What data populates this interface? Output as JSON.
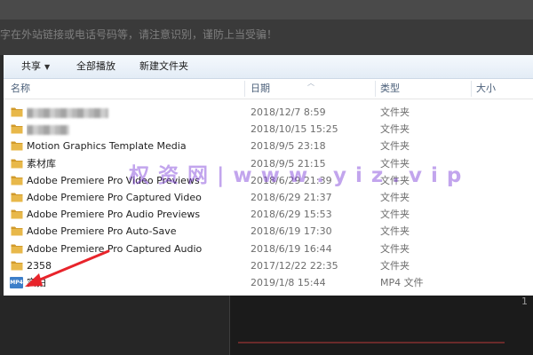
{
  "background": {
    "top_text": "字在外站链接或电话号码等，请注意识别，谨防上当受骗！",
    "bottom_number": "1"
  },
  "toolbar": {
    "share_label": "共享",
    "play_all_label": "全部播放",
    "new_folder_label": "新建文件夹"
  },
  "columns": {
    "name": "名称",
    "date": "日期",
    "type": "类型",
    "size": "大小"
  },
  "files": [
    {
      "name": "",
      "date": "2018/12/7 8:59",
      "type": "文件夹",
      "icon": "folder-icon",
      "blurred": true
    },
    {
      "name": "",
      "date": "2018/10/15 15:25",
      "type": "文件夹",
      "icon": "folder-icon",
      "blurred": true
    },
    {
      "name": "Motion Graphics Template Media",
      "date": "2018/9/5 23:18",
      "type": "文件夹",
      "icon": "folder-icon"
    },
    {
      "name": "素材库",
      "date": "2018/9/5 21:15",
      "type": "文件夹",
      "icon": "folder-icon"
    },
    {
      "name": "Adobe Premiere Pro Video Previews",
      "date": "2018/6/29 21:39",
      "type": "文件夹",
      "icon": "folder-icon"
    },
    {
      "name": "Adobe Premiere Pro Captured Video",
      "date": "2018/6/29 21:37",
      "type": "文件夹",
      "icon": "folder-icon"
    },
    {
      "name": "Adobe Premiere Pro Audio Previews",
      "date": "2018/6/29 15:53",
      "type": "文件夹",
      "icon": "folder-icon"
    },
    {
      "name": "Adobe Premiere Pro Auto-Save",
      "date": "2018/6/19 17:30",
      "type": "文件夹",
      "icon": "folder-icon"
    },
    {
      "name": "Adobe Premiere Pro Captured Audio",
      "date": "2018/6/19 16:44",
      "type": "文件夹",
      "icon": "folder-icon"
    },
    {
      "name": "2358",
      "date": "2017/12/22 22:35",
      "type": "文件夹",
      "icon": "folder-icon"
    },
    {
      "name": "实拍",
      "date": "2019/1/8 15:44",
      "type": "MP4 文件",
      "icon": "mp4-file-icon",
      "icon_text": "MP4"
    }
  ],
  "watermark": "权 资 网 | w w w . y i z . v i p",
  "colors": {
    "folder": "#e8b84a",
    "folder_dark": "#d19a2a",
    "arrow": "#e8242b",
    "watermark": "#7a39d8",
    "mp4_icon": "#3d7fc9"
  }
}
